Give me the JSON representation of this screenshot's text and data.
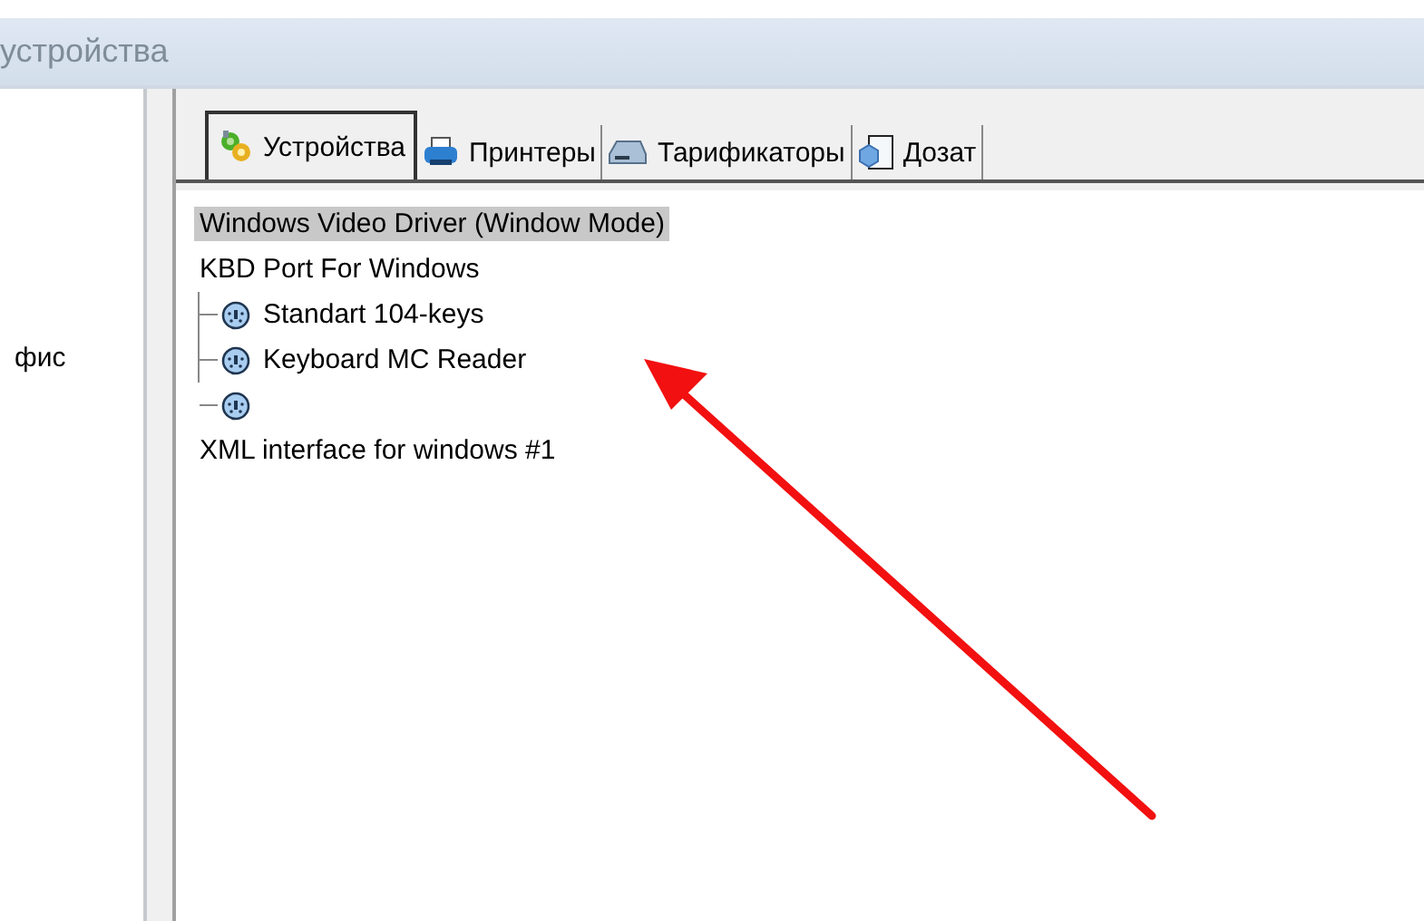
{
  "window": {
    "title": "устройства"
  },
  "sidebar": {
    "items": [
      {
        "label": "фис"
      }
    ]
  },
  "tabs": [
    {
      "label": "Устройства",
      "selected": true
    },
    {
      "label": "Принтеры",
      "selected": false
    },
    {
      "label": "Тарификаторы",
      "selected": false
    },
    {
      "label": "Дозат",
      "selected": false
    }
  ],
  "tree": [
    {
      "label": "Windows Video Driver (Window Mode)",
      "selected": true
    },
    {
      "label": "KBD Port For Windows",
      "selected": false,
      "children": [
        {
          "label": "Standart 104-keys",
          "selected": false
        },
        {
          "label": "Keyboard MC Reader",
          "selected": false
        },
        {
          "selected": false
        }
      ]
    },
    {
      "label": "XML interface for windows #1",
      "selected": false
    }
  ],
  "annotation": {
    "kind": "arrow"
  }
}
